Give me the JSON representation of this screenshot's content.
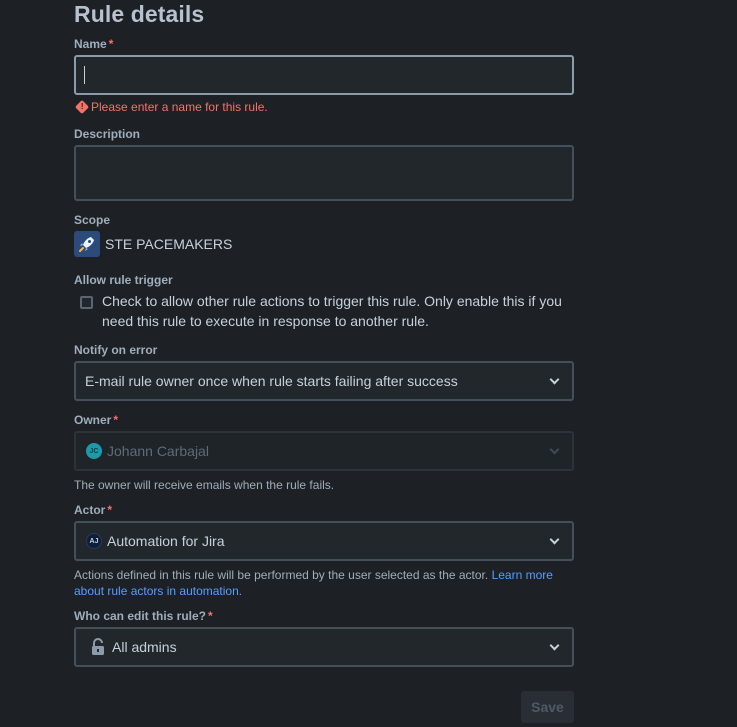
{
  "title": "Rule details",
  "name": {
    "label": "Name",
    "required": "*",
    "value": "",
    "error": "Please enter a name for this rule."
  },
  "description": {
    "label": "Description",
    "value": ""
  },
  "scope": {
    "label": "Scope",
    "value": "STE PACEMAKERS",
    "icon": "rocket-icon"
  },
  "allow_trigger": {
    "label": "Allow rule trigger",
    "checked": false,
    "text": "Check to allow other rule actions to trigger this rule. Only enable this if you need this rule to execute in response to another rule."
  },
  "notify": {
    "label": "Notify on error",
    "value": "E-mail rule owner once when rule starts failing after success"
  },
  "owner": {
    "label": "Owner",
    "required": "*",
    "avatar": "JC",
    "value": "Johann Carbajal",
    "help": "The owner will receive emails when the rule fails.",
    "disabled": true
  },
  "actor": {
    "label": "Actor",
    "required": "*",
    "avatar": "AJ",
    "value": "Automation for Jira",
    "help_text": "Actions defined in this rule will be performed by the user selected as the actor.",
    "help_link_1": "Learn more",
    "help_link_2": "about rule actors in automation."
  },
  "editors": {
    "label": "Who can edit this rule?",
    "required": "*",
    "value": "All admins",
    "icon": "unlock-icon"
  },
  "save_label": "Save",
  "colors": {
    "background": "#1d2125",
    "error": "#f87168",
    "link": "#579dff",
    "owner_avatar": "#1d9aaa"
  }
}
